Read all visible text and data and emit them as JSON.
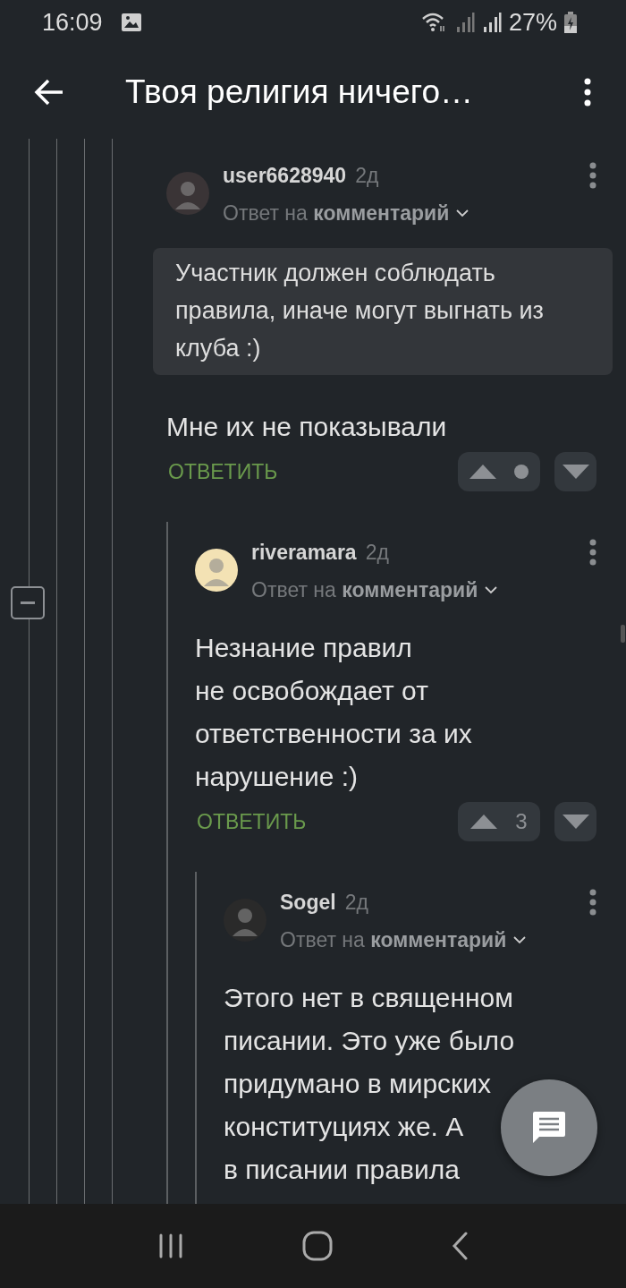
{
  "status_bar": {
    "time": "16:09",
    "battery": "27%"
  },
  "toolbar": {
    "title": "Твоя религия ничего…"
  },
  "comments": [
    {
      "author": "user6628940",
      "time": "2д",
      "reply_prefix": "Ответ на",
      "reply_target": "комментарий",
      "quote": "Участник должен соблюдать правила, иначе могут выгнать из клуба :)",
      "body": "Мне их не показывали",
      "reply_action": "ОТВЕТИТЬ",
      "rating_hidden": true,
      "children": [
        {
          "author": "riveramara",
          "time": "2д",
          "reply_prefix": "Ответ на",
          "reply_target": "комментарий",
          "body": "Незнание правил\nне освобождает от\nответственности за их\nнарушение :)",
          "reply_action": "ОТВЕТИТЬ",
          "rating_hidden": false,
          "rating": "3",
          "children": [
            {
              "author": "Sogel",
              "time": "2д",
              "reply_prefix": "Ответ на",
              "reply_target": "комментарий",
              "body": "Этого нет в священном\nписании. Это уже было\nпридумано в мирских\nконституциях же. А\nв писании правила"
            }
          ]
        }
      ]
    }
  ]
}
